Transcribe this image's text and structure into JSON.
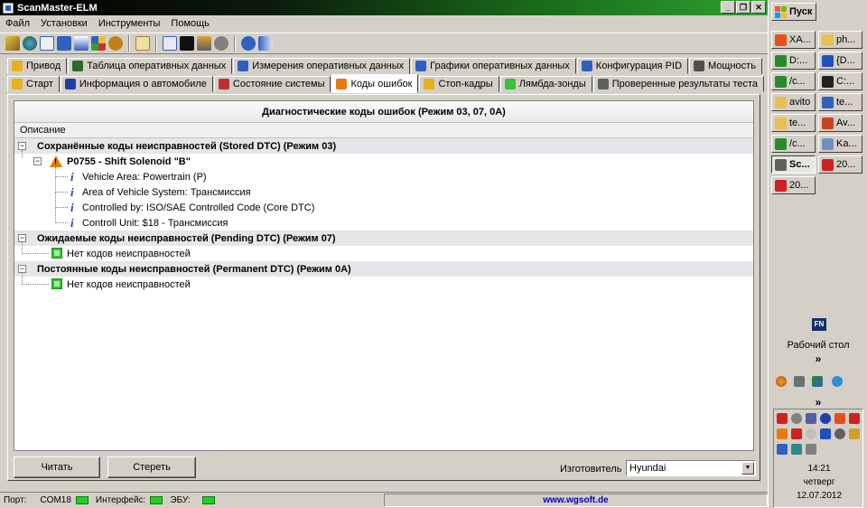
{
  "window": {
    "title": "ScanMaster-ELM",
    "menu": [
      "Файл",
      "Установки",
      "Инструменты",
      "Помощь"
    ]
  },
  "tabs": {
    "row1": [
      {
        "label": "Привод",
        "icon": "drive-icon",
        "color": "#e8b020"
      },
      {
        "label": "Таблица оперативных данных",
        "icon": "table-icon",
        "color": "#2a6a2a"
      },
      {
        "label": "Измерения оперативных данных",
        "icon": "gauge-icon",
        "color": "#3060c0"
      },
      {
        "label": "Графики оперативных данных",
        "icon": "graph-icon",
        "color": "#3060c0"
      },
      {
        "label": "Конфигурация PID",
        "icon": "config-icon",
        "color": "#3060c0"
      },
      {
        "label": "Мощность",
        "icon": "power-icon",
        "color": "#505050"
      }
    ],
    "row2": [
      {
        "label": "Старт",
        "icon": "start-icon",
        "color": "#e8b020"
      },
      {
        "label": "Информация о автомобиле",
        "icon": "info-icon",
        "color": "#1f3fa8"
      },
      {
        "label": "Состояние системы",
        "icon": "status-icon",
        "color": "#c03030"
      },
      {
        "label": "Коды ошибок",
        "icon": "warning-icon",
        "color": "#e87a10"
      },
      {
        "label": "Стоп-кадры",
        "icon": "freeze-icon",
        "color": "#e8b020"
      },
      {
        "label": "Лямбда-зонды",
        "icon": "lambda-icon",
        "color": "#38c038"
      },
      {
        "label": "Проверенные результаты теста",
        "icon": "test-icon",
        "color": "#606060"
      }
    ],
    "active": "Коды ошибок"
  },
  "dtc": {
    "title": "Диагностические коды ошибок (Режим 03, 07, 0A)",
    "column": "Описание",
    "stored": {
      "header": "Сохранённые коды неисправностей (Stored DTC) (Режим 03)",
      "code": "P0755 - Shift Solenoid \"B\"",
      "details": [
        "Vehicle Area: Powertrain (P)",
        "Area of Vehicle System: Трансмиссия",
        "Controlled by: ISO/SAE Controlled Code (Core DTC)",
        "Controll Unit: $18 - Трансмиссия"
      ]
    },
    "pending": {
      "header": "Ожидаемые коды неисправностей (Pending DTC) (Режим 07)",
      "item": "Нет кодов неисправностей"
    },
    "permanent": {
      "header": "Постоянные коды неисправностей (Permanent DTC) (Режим 0A)",
      "item": "Нет кодов неисправностей"
    }
  },
  "buttons": {
    "read": "Читать",
    "clear": "Стереть"
  },
  "manufacturer": {
    "label": "Изготовитель",
    "value": "Hyundai"
  },
  "statusbar": {
    "port_label": "Порт:",
    "port": "COM18",
    "interface_label": "Интерфейс:",
    "ecu_label": "ЭБУ:",
    "url": "www.wgsoft.de"
  },
  "taskbar": {
    "start": "Пуск",
    "buttons": [
      {
        "label": "XA...",
        "color": "#e8501a"
      },
      {
        "label": "ph...",
        "color": "#e8c050"
      },
      {
        "label": "D:...",
        "color": "#2a8a2a"
      },
      {
        "label": "{D...",
        "color": "#2050c0"
      },
      {
        "label": "/c...",
        "color": "#2a8a2a"
      },
      {
        "label": "C:...",
        "color": "#202020"
      },
      {
        "label": "avito",
        "color": "#e8c050"
      },
      {
        "label": "te...",
        "color": "#3060c0"
      },
      {
        "label": "te...",
        "color": "#e8c050"
      },
      {
        "label": "Av...",
        "color": "#d04020"
      },
      {
        "label": "/c...",
        "color": "#2a8a2a"
      },
      {
        "label": "Ka...",
        "color": "#7090c0"
      },
      {
        "label": "Sc...",
        "color": "#606060"
      },
      {
        "label": "20...",
        "color": "#d02020"
      },
      {
        "label": "20...",
        "color": "#d02020"
      }
    ],
    "fn": "FN",
    "desktop": "Рабочий стол",
    "chevron": "»",
    "time": "14:21",
    "day": "четверг",
    "date": "12.07.2012"
  }
}
